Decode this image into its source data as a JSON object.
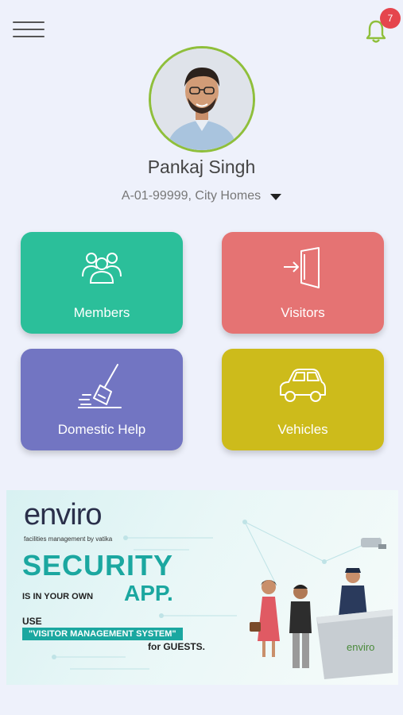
{
  "header": {
    "menu_icon": "hamburger-menu-icon",
    "bell_icon": "bell-icon",
    "notification_count": "7",
    "accent_color": "#8fbf3b",
    "badge_color": "#e5454d"
  },
  "profile": {
    "name": "Pankaj Singh",
    "unit": "A-01-99999, City Homes"
  },
  "tiles": [
    {
      "label": "Members",
      "icon": "members-icon",
      "color": "#2bbf9a"
    },
    {
      "label": "Visitors",
      "icon": "visitor-entry-icon",
      "color": "#e57373"
    },
    {
      "label": "Domestic Help",
      "icon": "broom-icon",
      "color": "#7275c2"
    },
    {
      "label": "Vehicles",
      "icon": "car-icon",
      "color": "#cdbb1b"
    }
  ],
  "banner": {
    "brand": "enviro",
    "brand_sub": "facilities management by vatika",
    "headline": "SECURITY",
    "line2": "IS IN YOUR OWN",
    "app_word": "APP.",
    "use": "USE",
    "highlight": "\"VISITOR MANAGEMENT SYSTEM\"",
    "tail": "for GUESTS.",
    "desk_brand": "enviro"
  }
}
